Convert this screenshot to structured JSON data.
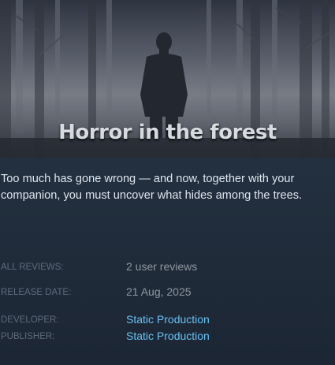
{
  "capsule": {
    "title": "Horror in the forest"
  },
  "description": "Too much has gone wrong — and now, together with your companion, you must uncover what hides among the trees.",
  "reviews": {
    "label": "ALL REVIEWS:",
    "value": "2 user reviews"
  },
  "release": {
    "label": "RELEASE DATE:",
    "value": "21 Aug, 2025"
  },
  "developer": {
    "label": "DEVELOPER:",
    "value": "Static Production"
  },
  "publisher": {
    "label": "PUBLISHER:",
    "value": "Static Production"
  }
}
